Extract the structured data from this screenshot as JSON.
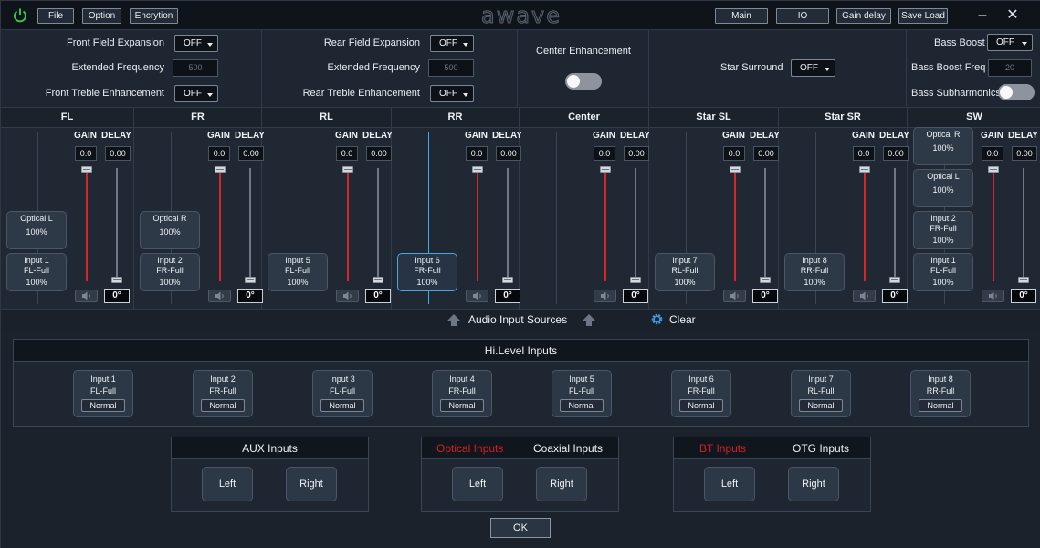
{
  "titlebar": {
    "menu": [
      "File",
      "Option",
      "Encrytion"
    ],
    "logo_text": "awave",
    "nav": [
      "Main",
      "IO",
      "Gain delay",
      "Save Load"
    ],
    "power_color": "#3cc24a"
  },
  "settings": {
    "front": {
      "field_expansion_label": "Front Field Expansion",
      "field_expansion_value": "OFF",
      "extended_freq_label": "Extended Frequency",
      "extended_freq_value": "500",
      "treble_label": "Front Treble Enhancement",
      "treble_value": "OFF"
    },
    "rear": {
      "field_expansion_label": "Rear Field Expansion",
      "field_expansion_value": "OFF",
      "extended_freq_label": "Extended Frequency",
      "extended_freq_value": "500",
      "treble_label": "Rear Treble Enhancement",
      "treble_value": "OFF"
    },
    "center": {
      "label": "Center Enhancement",
      "enabled": false
    },
    "star": {
      "label": "Star Surround",
      "value": "OFF"
    },
    "bass": {
      "boost_label": "Bass Boost",
      "boost_value": "OFF",
      "freq_label": "Bass Boost Freq",
      "freq_value": "20",
      "subharmonics_label": "Bass Subharmonics",
      "subharmonics_enabled": false
    }
  },
  "channel_labels": {
    "gain": "GAIN",
    "delay": "DELAY"
  },
  "channels": [
    {
      "name": "FL",
      "gain": "0.0",
      "delay": "0.00",
      "phase": "0°",
      "sources": [
        {
          "name": "Optical L",
          "sub": "",
          "pct": "100%"
        },
        {
          "name": "Input 1",
          "sub": "FL-Full",
          "pct": "100%"
        }
      ]
    },
    {
      "name": "FR",
      "gain": "0.0",
      "delay": "0.00",
      "phase": "0°",
      "sources": [
        {
          "name": "Optical R",
          "sub": "",
          "pct": "100%"
        },
        {
          "name": "Input 2",
          "sub": "FR-Full",
          "pct": "100%"
        }
      ]
    },
    {
      "name": "RL",
      "gain": "0.0",
      "delay": "0.00",
      "phase": "0°",
      "sources": [
        {
          "name": "Input 5",
          "sub": "FL-Full",
          "pct": "100%"
        }
      ]
    },
    {
      "name": "RR",
      "gain": "0.0",
      "delay": "0.00",
      "phase": "0°",
      "sources": [
        {
          "name": "Input 6",
          "sub": "FR-Full",
          "pct": "100%"
        }
      ]
    },
    {
      "name": "Center",
      "gain": "0.0",
      "delay": "0.00",
      "phase": "0°",
      "sources": []
    },
    {
      "name": "Star SL",
      "gain": "0.0",
      "delay": "0.00",
      "phase": "0°",
      "sources": [
        {
          "name": "Input 7",
          "sub": "RL-Full",
          "pct": "100%"
        }
      ]
    },
    {
      "name": "Star SR",
      "gain": "0.0",
      "delay": "0.00",
      "phase": "0°",
      "sources": [
        {
          "name": "Input 8",
          "sub": "RR-Full",
          "pct": "100%"
        }
      ]
    },
    {
      "name": "SW",
      "gain": "0.0",
      "delay": "0.00",
      "phase": "0°",
      "sources": [
        {
          "name": "Optical R",
          "sub": "",
          "pct": "100%"
        },
        {
          "name": "Optical L",
          "sub": "",
          "pct": "100%"
        },
        {
          "name": "Input 2",
          "sub": "FR-Full",
          "pct": "100%"
        },
        {
          "name": "Input 1",
          "sub": "FL-Full",
          "pct": "100%"
        }
      ]
    }
  ],
  "sources_bar": {
    "label": "Audio Input Sources",
    "clear": "Clear"
  },
  "hilevel": {
    "title": "Hi.Level Inputs",
    "inputs": [
      {
        "name": "Input 1",
        "sub": "FL-Full",
        "mode": "Normal"
      },
      {
        "name": "Input 2",
        "sub": "FR-Full",
        "mode": "Normal"
      },
      {
        "name": "Input 3",
        "sub": "FL-Full",
        "mode": "Normal"
      },
      {
        "name": "Input 4",
        "sub": "FR-Full",
        "mode": "Normal"
      },
      {
        "name": "Input 5",
        "sub": "FL-Full",
        "mode": "Normal"
      },
      {
        "name": "Input 6",
        "sub": "FR-Full",
        "mode": "Normal"
      },
      {
        "name": "Input 7",
        "sub": "RL-Full",
        "mode": "Normal"
      },
      {
        "name": "Input 8",
        "sub": "RR-Full",
        "mode": "Normal"
      }
    ]
  },
  "aux": {
    "title": "AUX Inputs",
    "left": "Left",
    "right": "Right"
  },
  "optical_coax": {
    "tab_a": "Optical Inputs",
    "tab_b": "Coaxial Inputs",
    "left": "Left",
    "right": "Right"
  },
  "bt_otg": {
    "tab_a": "BT Inputs",
    "tab_b": "OTG Inputs",
    "left": "Left",
    "right": "Right"
  },
  "ok_label": "OK"
}
